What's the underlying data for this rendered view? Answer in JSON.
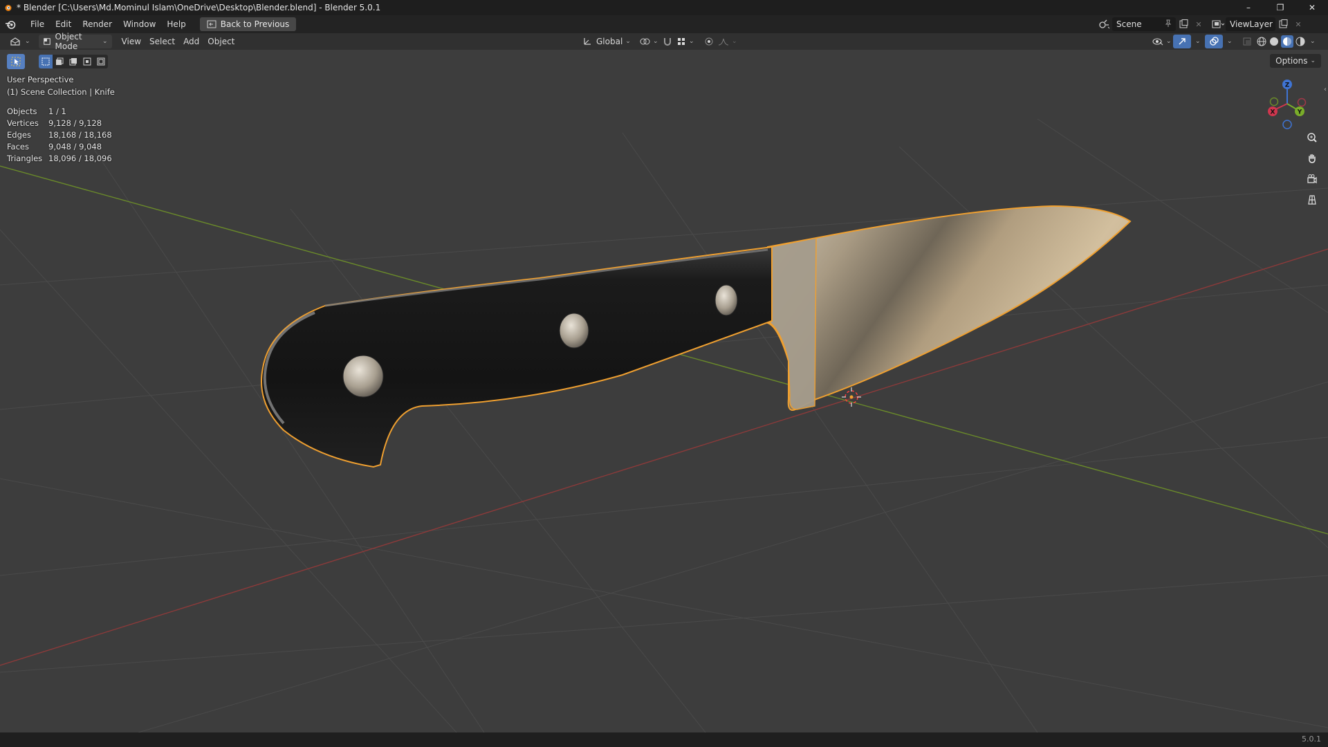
{
  "window": {
    "title": "* Blender [C:\\Users\\Md.Mominul Islam\\OneDrive\\Desktop\\Blender.blend] - Blender 5.0.1",
    "minimize": "–",
    "restore": "❐",
    "close": "✕"
  },
  "topbar": {
    "menus": [
      "File",
      "Edit",
      "Render",
      "Window",
      "Help"
    ],
    "back_button": "Back to Previous",
    "scene": "Scene",
    "view_layer": "ViewLayer"
  },
  "viewport_header": {
    "mode": "Object Mode",
    "menus": [
      "View",
      "Select",
      "Add",
      "Object"
    ],
    "transform_orientation": "Global"
  },
  "viewport": {
    "options": "Options",
    "perspective": "User Perspective",
    "collection": "(1) Scene Collection | Knife",
    "stats": [
      {
        "label": "Objects",
        "value": "1 / 1"
      },
      {
        "label": "Vertices",
        "value": "9,128 / 9,128"
      },
      {
        "label": "Edges",
        "value": "18,168 / 18,168"
      },
      {
        "label": "Faces",
        "value": "9,048 / 9,048"
      },
      {
        "label": "Triangles",
        "value": "18,096 / 18,096"
      }
    ],
    "gizmo": {
      "x": "X",
      "y": "Y",
      "z": "Z"
    },
    "selection_color": "#f0a030"
  },
  "status": {
    "version": "5.0.1"
  }
}
